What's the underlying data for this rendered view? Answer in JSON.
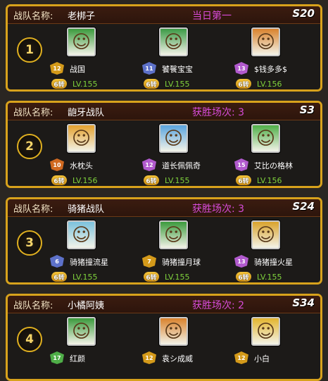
{
  "team_label": "战队名称:",
  "cards": [
    {
      "team_name": "老梆子",
      "status": "当日第一",
      "server": "S20",
      "rank": "1",
      "members": [
        {
          "name": "战国",
          "badge": "12",
          "turn": "6转",
          "level": "LV.155",
          "badge_color": "#d49a1a",
          "portrait_color": "#3a9a3c"
        },
        {
          "name": "饕餮宝宝",
          "badge": "11",
          "turn": "6转",
          "level": "LV.155",
          "badge_color": "#5d71c9",
          "portrait_color": "#3b9a45"
        },
        {
          "name": "$钱多多$",
          "badge": "13",
          "turn": "6转",
          "level": "LV.156",
          "badge_color": "#b15acd",
          "portrait_color": "#d9822c"
        }
      ]
    },
    {
      "team_name": "龅牙战队",
      "status": "获胜场次: 3",
      "server": "S3",
      "rank": "2",
      "members": [
        {
          "name": "水枕头",
          "badge": "10",
          "turn": "6转",
          "level": "LV.156",
          "badge_color": "#d06920",
          "portrait_color": "#e3a12e"
        },
        {
          "name": "道长佩佩奇",
          "badge": "12",
          "turn": "6转",
          "level": "LV.155",
          "badge_color": "#b15acd",
          "portrait_color": "#5aa5df"
        },
        {
          "name": "艾比の格林",
          "badge": "15",
          "turn": "6转",
          "level": "LV.156",
          "badge_color": "#b15acd",
          "portrait_color": "#4fae48"
        }
      ]
    },
    {
      "team_name": "骑猪战队",
      "status": "获胜场次: 3",
      "server": "S24",
      "rank": "3",
      "members": [
        {
          "name": "骑猪撞流星",
          "badge": "6",
          "turn": "6转",
          "level": "LV.155",
          "badge_color": "#5d71c9",
          "portrait_color": "#7cc2dd"
        },
        {
          "name": "骑猪撞月球",
          "badge": "7",
          "turn": "6转",
          "level": "LV.155",
          "badge_color": "#d49a1a",
          "portrait_color": "#3a9a3c"
        },
        {
          "name": "骑猪撞火星",
          "badge": "13",
          "turn": "6转",
          "level": "LV.155",
          "badge_color": "#b15acd",
          "portrait_color": "#d9a32c"
        }
      ]
    },
    {
      "team_name": "小橘阿姨",
      "status": "获胜场次: 2",
      "server": "S34",
      "rank": "4",
      "members": [
        {
          "name": "红颜",
          "badge": "17",
          "turn": "",
          "level": "",
          "badge_color": "#4fae48",
          "portrait_color": "#3a9a3c"
        },
        {
          "name": "袁シ成威",
          "badge": "12",
          "turn": "",
          "level": "",
          "badge_color": "#d49a1a",
          "portrait_color": "#d9822c"
        },
        {
          "name": "小白",
          "badge": "12",
          "turn": "",
          "level": "",
          "badge_color": "#d49a1a",
          "portrait_color": "#e3b52e"
        }
      ]
    }
  ]
}
